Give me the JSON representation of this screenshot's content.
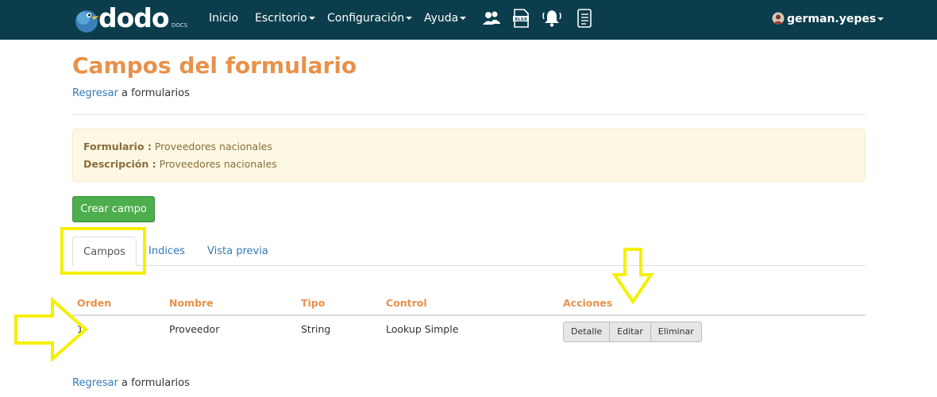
{
  "navbar": {
    "logo_text": "dodo",
    "logo_sub": "DOCS",
    "menu": [
      {
        "label": "Inicio",
        "has_caret": false
      },
      {
        "label": "Escritorio",
        "has_caret": true
      },
      {
        "label": "Configuración",
        "has_caret": true
      },
      {
        "label": "Ayuda",
        "has_caret": true
      }
    ],
    "icons": [
      "users-icon",
      "xlsx-file-icon",
      "bell-icon",
      "document-list-icon"
    ],
    "user": "german.yepes"
  },
  "page": {
    "title": "Campos del formulario",
    "back_link": "Regresar",
    "back_suffix": "a formularios"
  },
  "info": {
    "form_label": "Formulario :",
    "form_value": "Proveedores nacionales",
    "desc_label": "Descripción :",
    "desc_value": "Proveedores nacionales"
  },
  "create_button": "Crear campo",
  "tabs": [
    {
      "label": "Campos",
      "active": true
    },
    {
      "label": "Indices",
      "active": false
    },
    {
      "label": "Vista previa",
      "active": false
    }
  ],
  "table": {
    "headers": [
      "Orden",
      "Nombre",
      "Tipo",
      "Control",
      "Acciones"
    ],
    "rows": [
      {
        "orden": "1",
        "nombre": "Proveedor",
        "tipo": "String",
        "control": "Lookup Simple"
      }
    ],
    "actions": [
      "Detalle",
      "Editar",
      "Eliminar"
    ]
  },
  "colors": {
    "navbar": "#0b3d4c",
    "accent_orange": "#e8914a",
    "highlight_yellow": "#f5ef00",
    "success_green": "#4cae4c",
    "link_blue": "#337ab7"
  }
}
